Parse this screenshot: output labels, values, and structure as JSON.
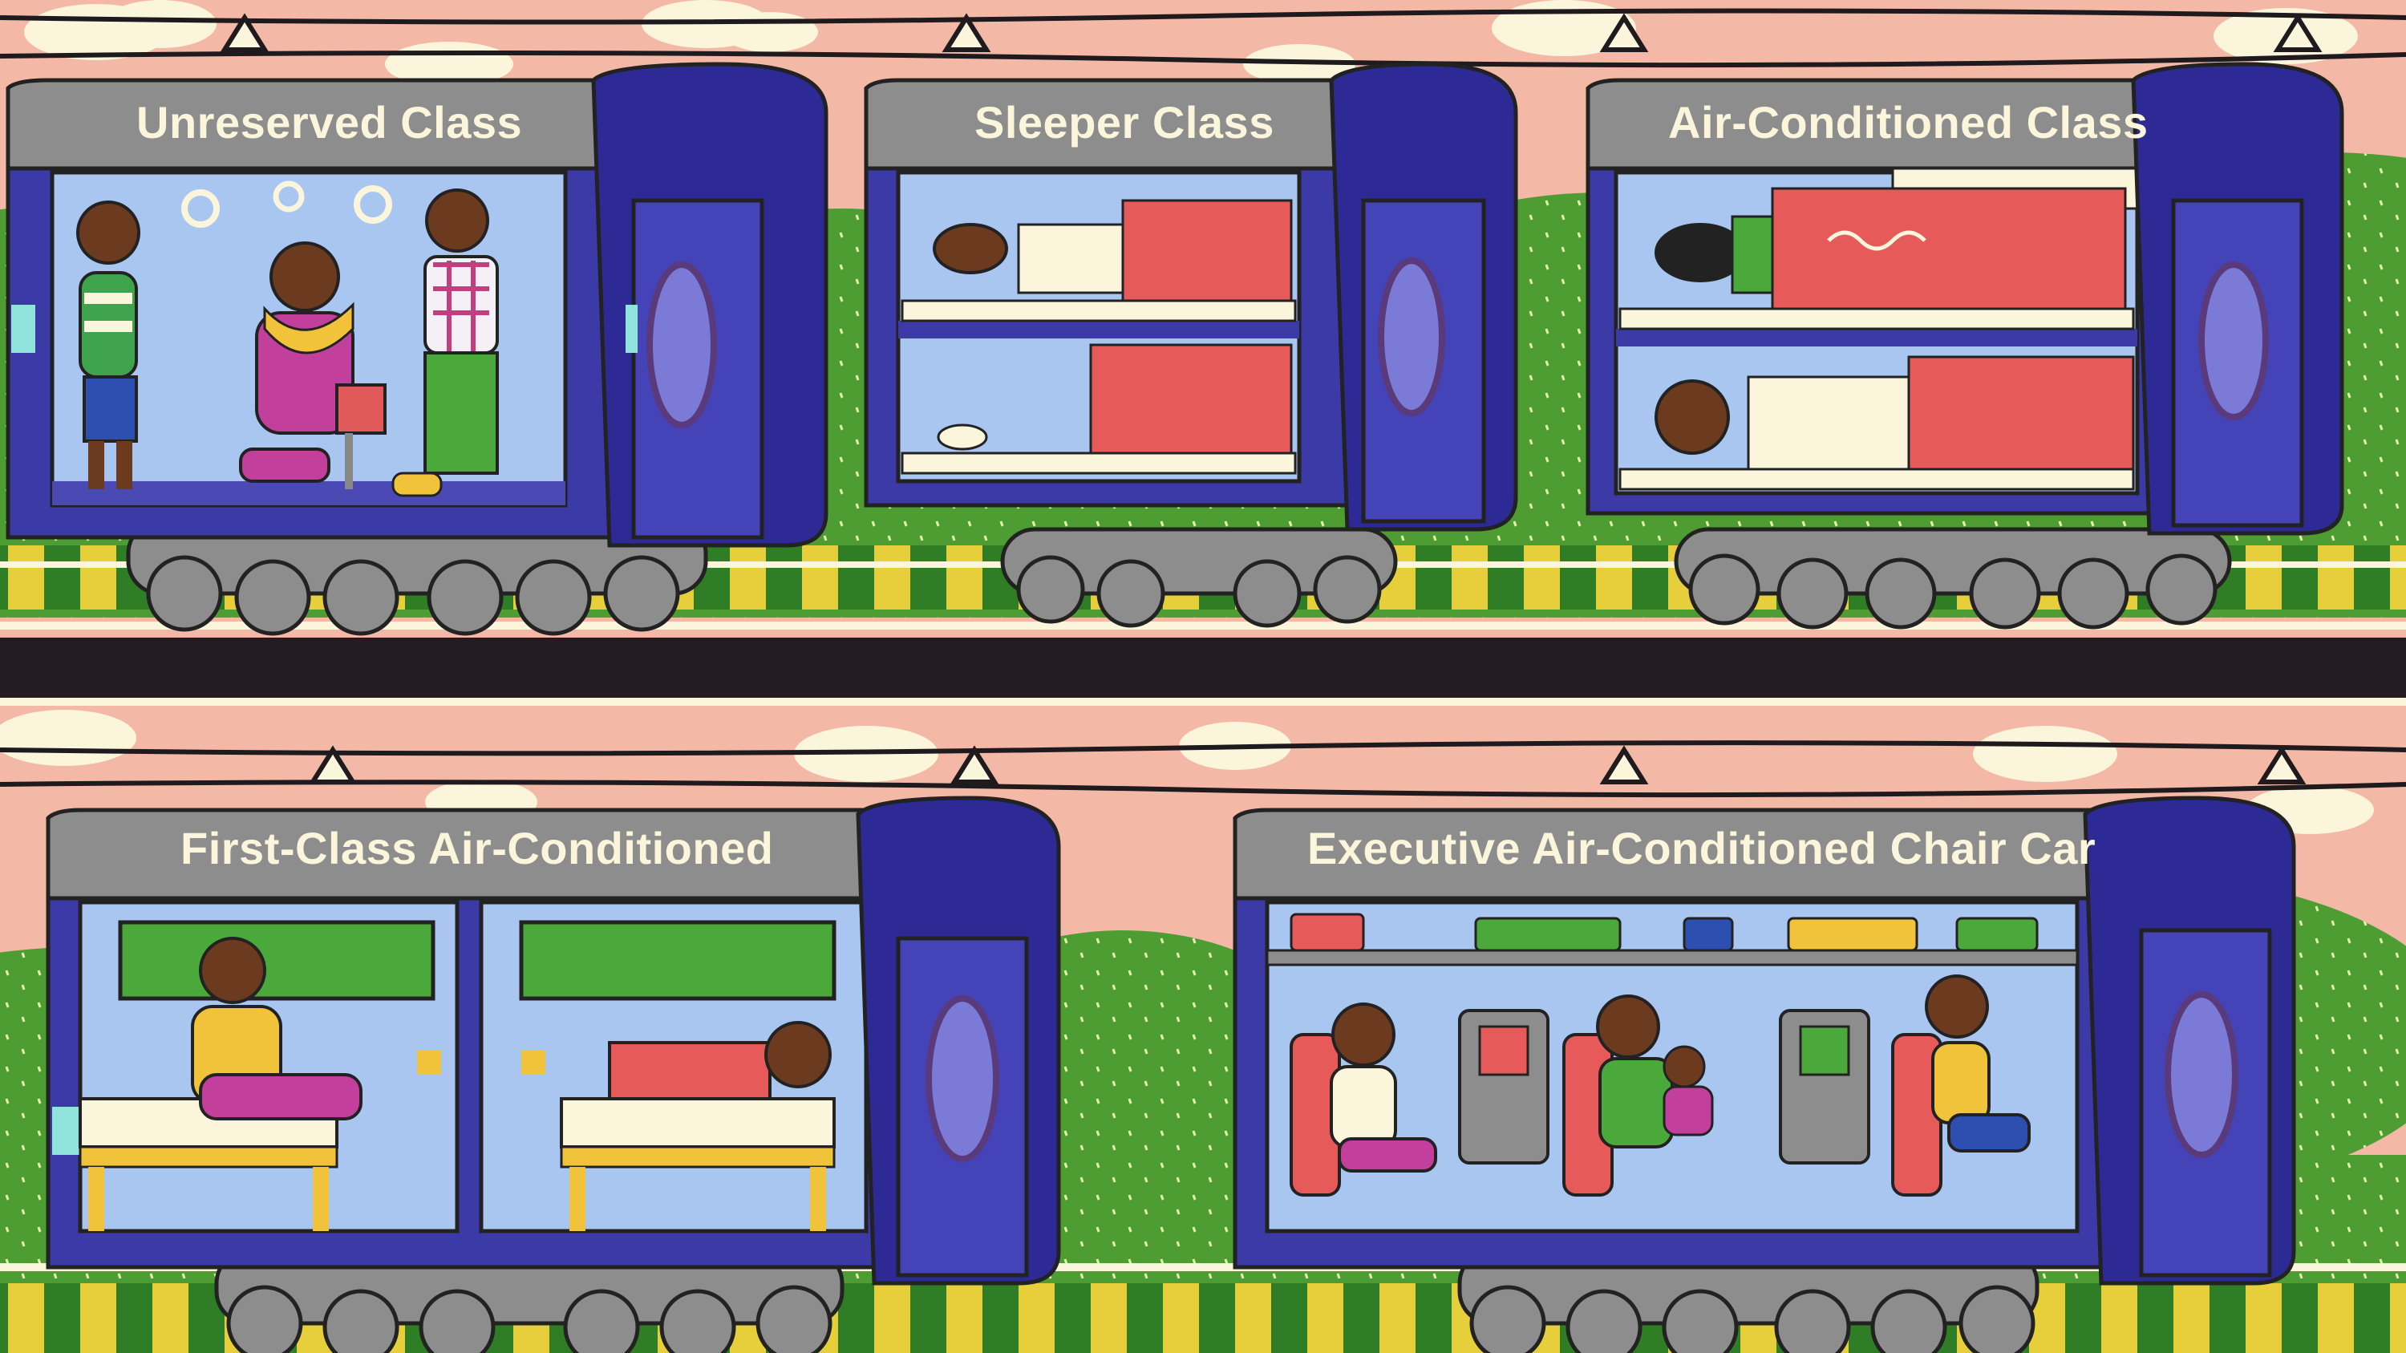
{
  "carriages": [
    {
      "id": "unreserved",
      "label": "Unreserved Class"
    },
    {
      "id": "sleeper",
      "label": "Sleeper Class"
    },
    {
      "id": "ac",
      "label": "Air-Conditioned Class"
    },
    {
      "id": "first-ac",
      "label": "First-Class Air-Conditioned"
    },
    {
      "id": "executive",
      "label": "Executive Air-Conditioned Chair Car"
    }
  ],
  "colors": {
    "sky": "#f4b9a6",
    "cloud": "#fbf5dc",
    "hill": "#58a63a",
    "grass": "#3f8f2a",
    "carriage_body": "#3b3aa6",
    "carriage_end": "#2d2a95",
    "roof": "#8d8d8d",
    "interior": "#a9c6f0",
    "stripe": "#8fe3da",
    "curtain": "#e65a5a",
    "rail": "#2a2326",
    "sleeper_yellow": "#e6cf3b"
  }
}
